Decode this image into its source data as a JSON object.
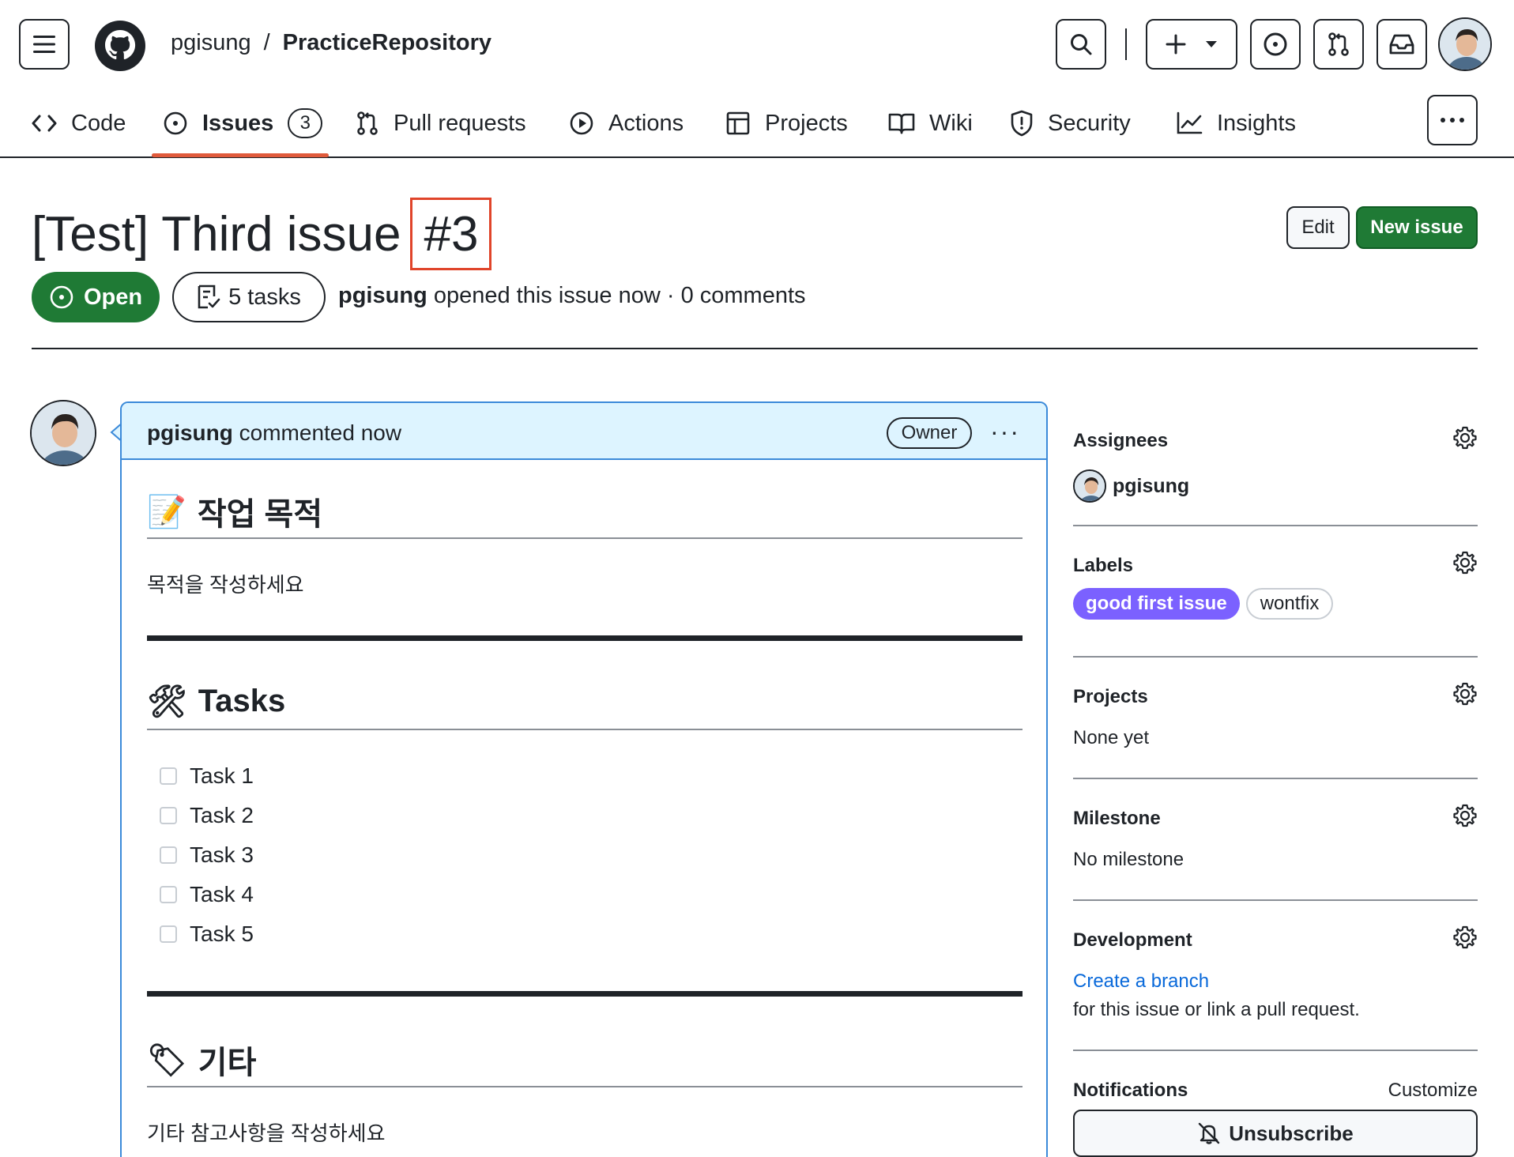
{
  "header": {
    "owner": "pgisung",
    "separator": "/",
    "repo": "PracticeRepository"
  },
  "nav": {
    "tabs": [
      {
        "label": "Code",
        "icon": "code-icon"
      },
      {
        "label": "Issues",
        "icon": "issue-opened-icon",
        "count": "3",
        "selected": true
      },
      {
        "label": "Pull requests",
        "icon": "git-pull-request-icon"
      },
      {
        "label": "Actions",
        "icon": "play-icon"
      },
      {
        "label": "Projects",
        "icon": "table-icon"
      },
      {
        "label": "Wiki",
        "icon": "book-icon"
      },
      {
        "label": "Security",
        "icon": "shield-icon"
      },
      {
        "label": "Insights",
        "icon": "graph-icon"
      }
    ]
  },
  "issue": {
    "title": "[Test] Third issue",
    "number": "#3",
    "edit_label": "Edit",
    "new_issue_label": "New issue",
    "state": "Open",
    "tasks": "5 tasks",
    "author": "pgisung",
    "meta_rest": "opened this issue now · 0 comments"
  },
  "comment": {
    "author": "pgisung",
    "time_text": "commented now",
    "badge": "Owner",
    "kebab": "···",
    "section1": {
      "emoji": "📝",
      "heading": "작업 목적",
      "text": "목적을 작성하세요"
    },
    "section2": {
      "emoji": "🛠",
      "heading": "Tasks"
    },
    "tasks": [
      "Task 1",
      "Task 2",
      "Task 3",
      "Task 4",
      "Task 5"
    ],
    "section3": {
      "emoji": "🏷",
      "heading": "기타",
      "text": "기타 참고사항을 작성하세요"
    }
  },
  "sidebar": {
    "assignees": {
      "title": "Assignees",
      "name": "pgisung"
    },
    "labels": {
      "title": "Labels",
      "items": [
        "good first issue",
        "wontfix"
      ],
      "colors": [
        "#7b61ff",
        "#ffffff"
      ]
    },
    "projects": {
      "title": "Projects",
      "value": "None yet"
    },
    "milestone": {
      "title": "Milestone",
      "value": "No milestone"
    },
    "development": {
      "title": "Development",
      "link": "Create a branch",
      "text": "for this issue or link a pull request."
    },
    "notifications": {
      "title": "Notifications",
      "customize": "Customize",
      "button": "Unsubscribe"
    }
  }
}
